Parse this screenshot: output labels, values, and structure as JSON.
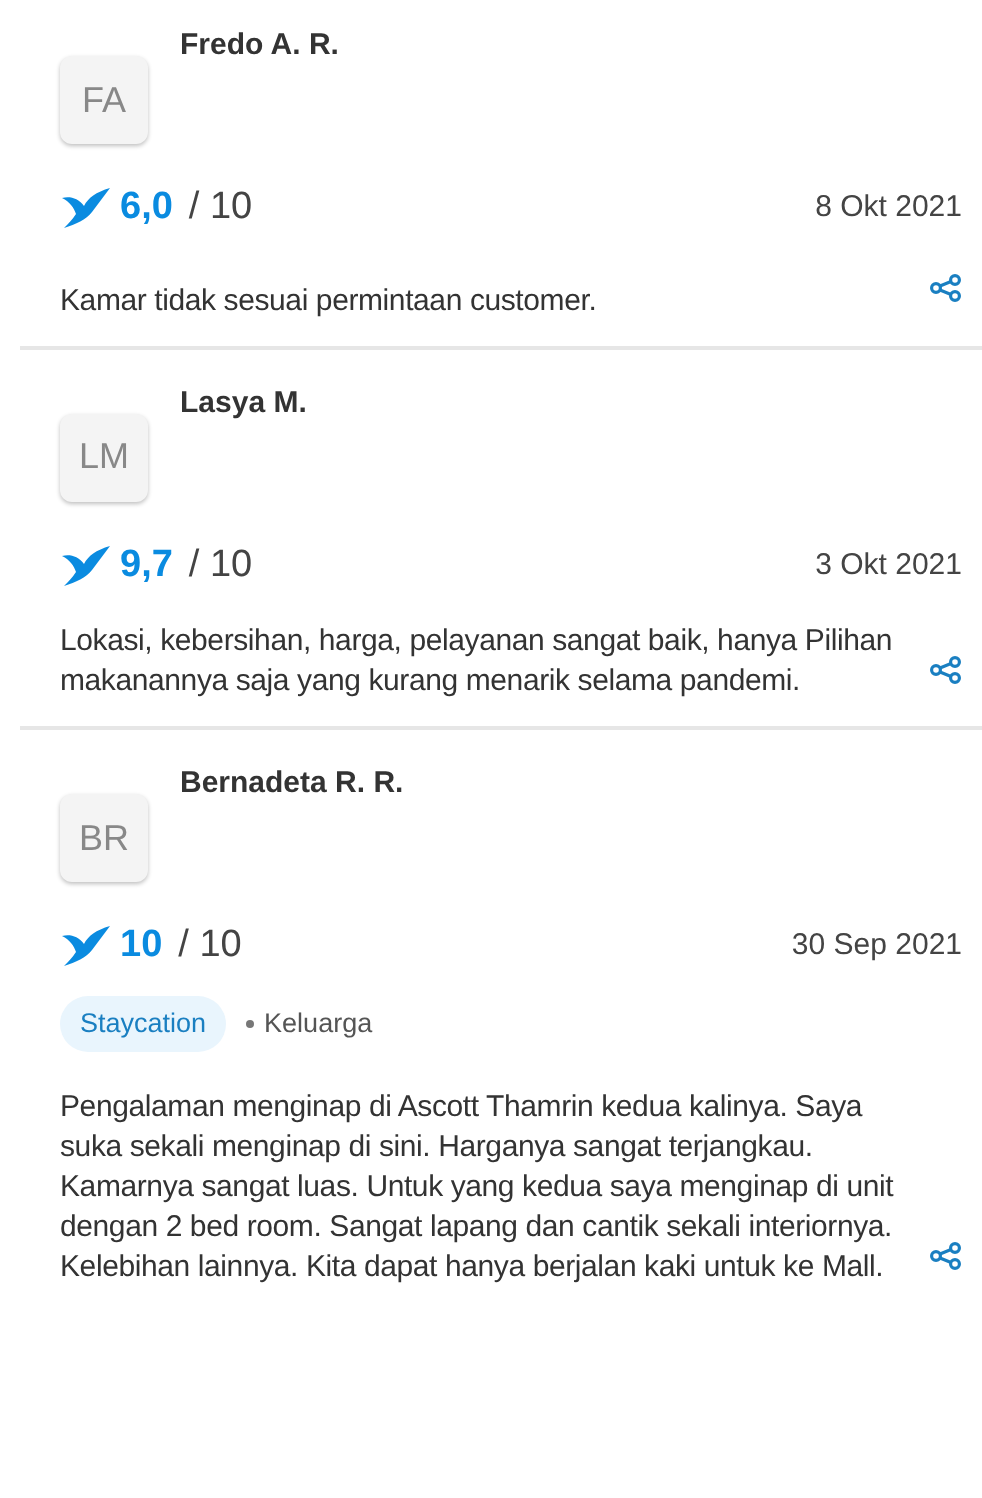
{
  "reviews": [
    {
      "initials": "FA",
      "name": "Fredo A. R.",
      "score": "6,0",
      "scale": "/ 10",
      "date": "8 Okt 2021",
      "text": "Kamar tidak sesuai permintaan customer."
    },
    {
      "initials": "LM",
      "name": "Lasya M.",
      "score": "9,7",
      "scale": "/ 10",
      "date": "3 Okt 2021",
      "text": "Lokasi, kebersihan, harga, pelayanan sangat baik, hanya Pilihan makanannya saja yang kurang menarik selama pandemi."
    },
    {
      "initials": "BR",
      "name": "Bernadeta R. R.",
      "score": "10",
      "scale": "/ 10",
      "date": "30 Sep 2021",
      "tags": [
        {
          "kind": "chip",
          "text": "Staycation"
        },
        {
          "kind": "plain",
          "text": "Keluarga"
        }
      ],
      "text": "Pengalaman menginap di Ascott Thamrin kedua kalinya. Saya suka sekali menginap di sini. Harganya sangat terjangkau. Kamarnya sangat luas. Untuk yang kedua saya menginap di unit dengan 2 bed room. Sangat lapang dan cantik sekali interiornya. Kelebihan lainnya. Kita dapat hanya berjalan kaki untuk ke Mall."
    }
  ]
}
